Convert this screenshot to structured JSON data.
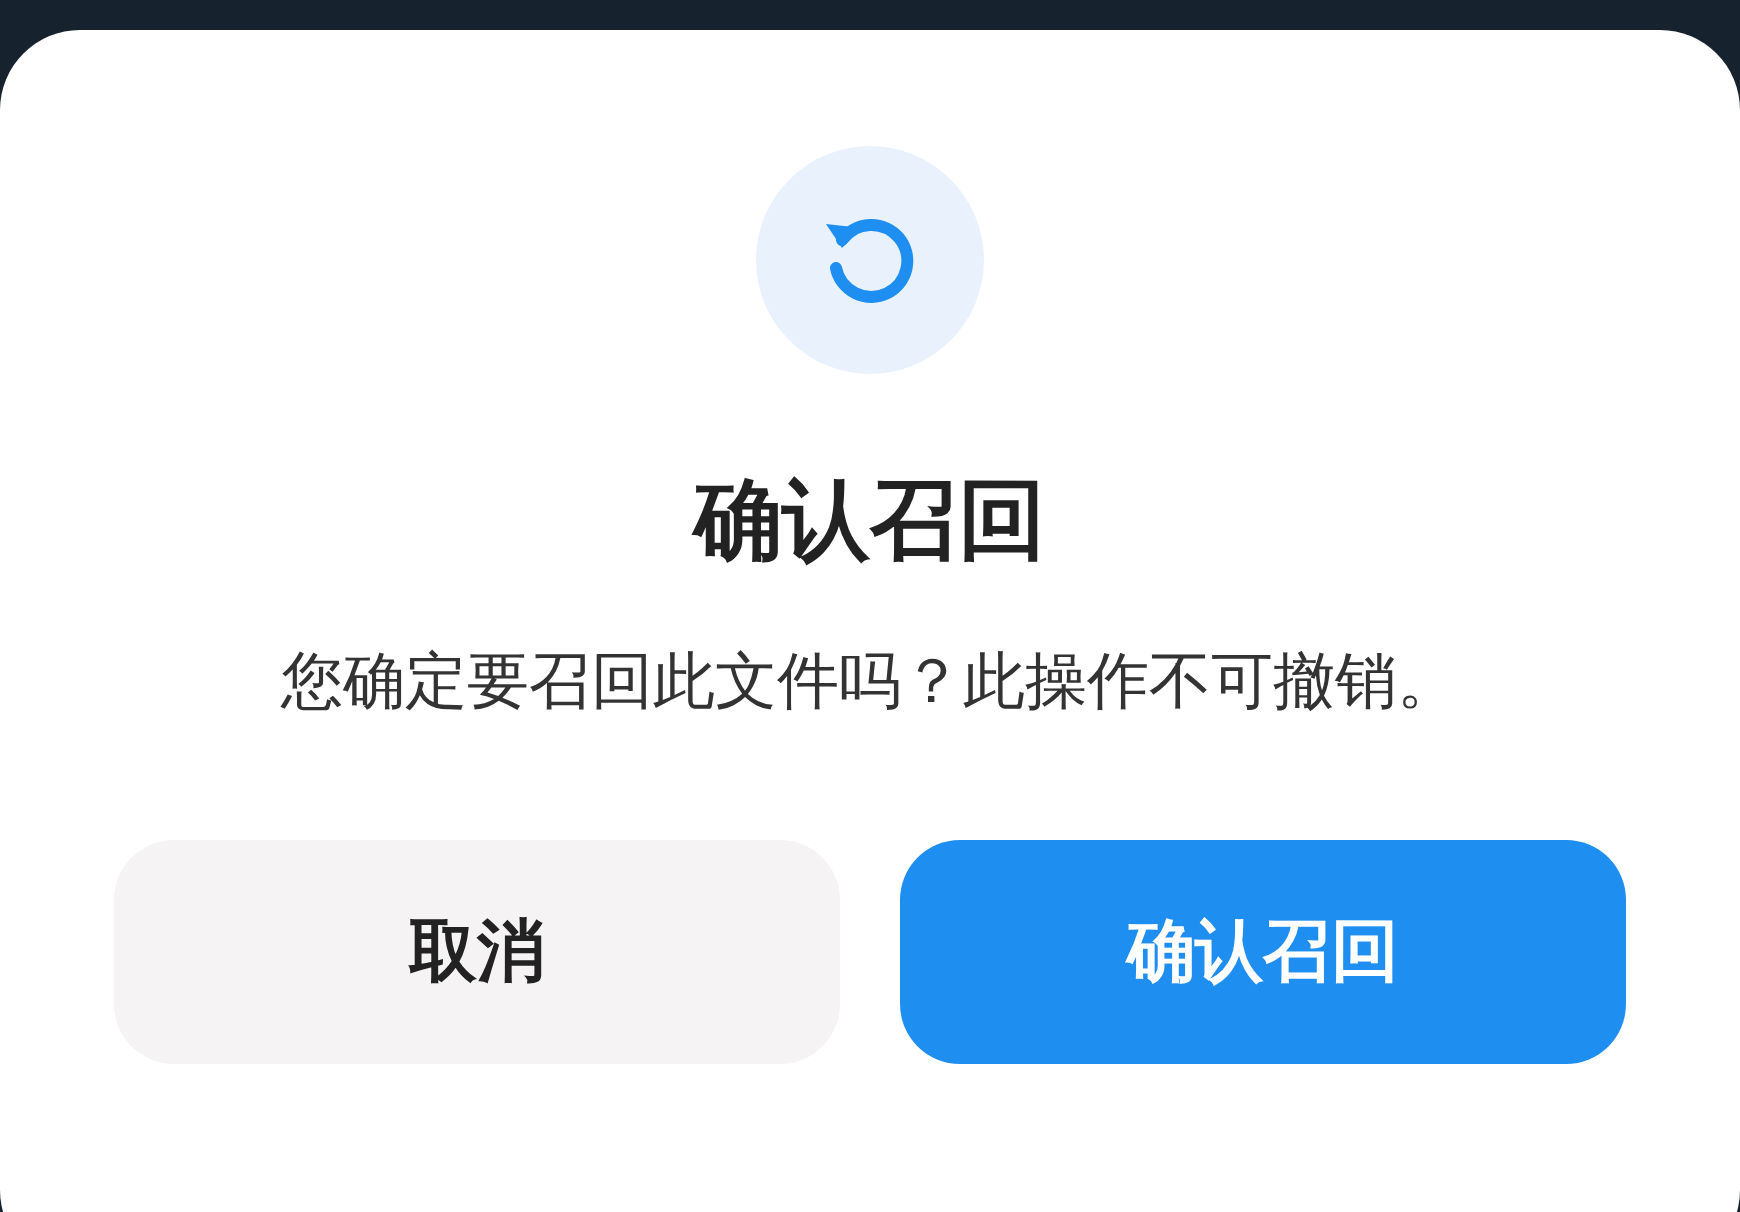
{
  "dialog": {
    "title": "确认召回",
    "message": "您确定要召回此文件吗？此操作不可撤销。",
    "buttons": [
      {
        "label": "取消",
        "kind": "secondary"
      },
      {
        "label": "确认召回",
        "kind": "primary"
      }
    ]
  }
}
